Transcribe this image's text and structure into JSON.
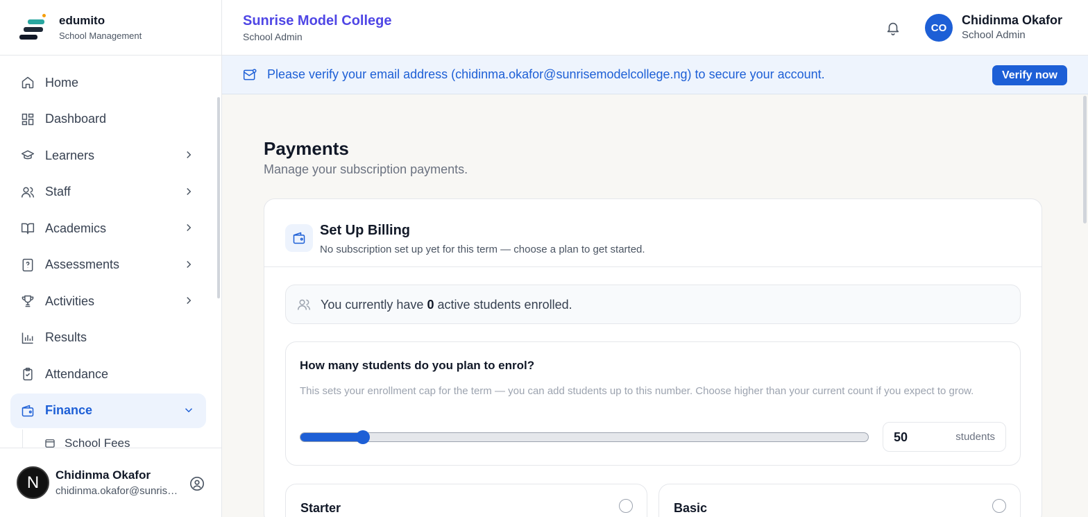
{
  "brand": {
    "name": "edumito",
    "subtitle": "School Management"
  },
  "sidebar": {
    "items": [
      {
        "label": "Home",
        "icon": "home-icon"
      },
      {
        "label": "Dashboard",
        "icon": "dashboard-icon"
      },
      {
        "label": "Learners",
        "icon": "graduation-cap-icon"
      },
      {
        "label": "Staff",
        "icon": "users-icon"
      },
      {
        "label": "Academics",
        "icon": "book-open-icon"
      },
      {
        "label": "Assessments",
        "icon": "file-question-icon"
      },
      {
        "label": "Activities",
        "icon": "trophy-icon"
      },
      {
        "label": "Results",
        "icon": "bar-chart-icon"
      },
      {
        "label": "Attendance",
        "icon": "clipboard-check-icon"
      },
      {
        "label": "Finance",
        "icon": "wallet-icon"
      }
    ],
    "sub_items": [
      {
        "label": "School Fees"
      }
    ],
    "user": {
      "initial": "N",
      "name": "Chidinma Okafor",
      "email": "chidinma.okafor@sunrisemodelcollege.ng"
    }
  },
  "header": {
    "school_name": "Sunrise Model College",
    "school_role": "School Admin",
    "user_initials": "CO",
    "user_name": "Chidinma Okafor",
    "user_role": "School Admin"
  },
  "banner": {
    "text": "Please verify your email address (chidinma.okafor@sunrisemodelcollege.ng) to secure your account.",
    "button": "Verify now"
  },
  "page": {
    "title": "Payments",
    "subtitle": "Manage your subscription payments."
  },
  "billing": {
    "title": "Set Up Billing",
    "subtitle": "No subscription set up yet for this term — choose a plan to get started.",
    "enrolled_prefix": "You currently have",
    "enrolled_count": "0",
    "enrolled_suffix": "active students enrolled.",
    "plan_question": "How many students do you plan to enrol?",
    "plan_help": "This sets your enrollment cap for the term — you can add students up to this number. Choose higher than your current count if you expect to grow.",
    "slider_fraction": 0.11,
    "student_count": "50",
    "student_unit": "students",
    "tiers": [
      {
        "name": "Starter"
      },
      {
        "name": "Basic"
      }
    ]
  },
  "colors": {
    "primary": "#1d5fd6",
    "school_name": "#4f46e5",
    "banner_bg": "#eef4fd"
  }
}
